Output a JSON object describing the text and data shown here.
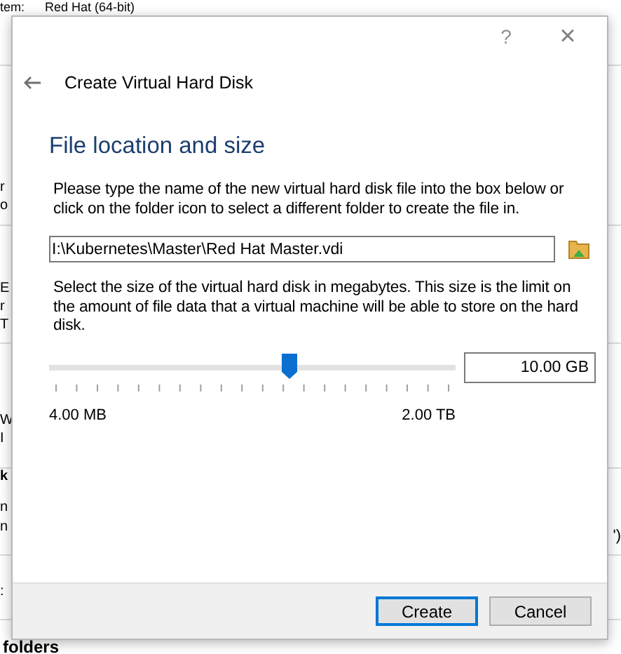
{
  "background_window": {
    "top_label": "tem:",
    "top_value": "Red Hat (64-bit)",
    "left_fragments": [
      "r",
      "o",
      "E",
      "r",
      "T",
      "W",
      "I",
      "k",
      "n",
      "n",
      ":"
    ],
    "right_fragment": "')",
    "bottom_heading": "folders"
  },
  "dialog": {
    "help": "?",
    "close": "×",
    "title": "Create Virtual Hard Disk",
    "heading": "File location and size",
    "location_text": "Please type the name of the new virtual hard disk file into the box below or click on the folder icon to select a different folder to create the file in.",
    "file_path": "I:\\Kubernetes\\Master\\Red Hat Master.vdi",
    "size_text": "Select the size of the virtual hard disk in megabytes. This size is the limit on the amount of file data that a virtual machine will be able to store on the hard disk.",
    "size_slider": {
      "level": 0.59,
      "min_label": "4.00 MB",
      "max_label": "2.00 TB"
    },
    "size_value": "10.00 GB",
    "buttons": [
      {
        "label": "Create",
        "selected": true
      },
      {
        "label": "Cancel",
        "selected": false
      }
    ]
  }
}
